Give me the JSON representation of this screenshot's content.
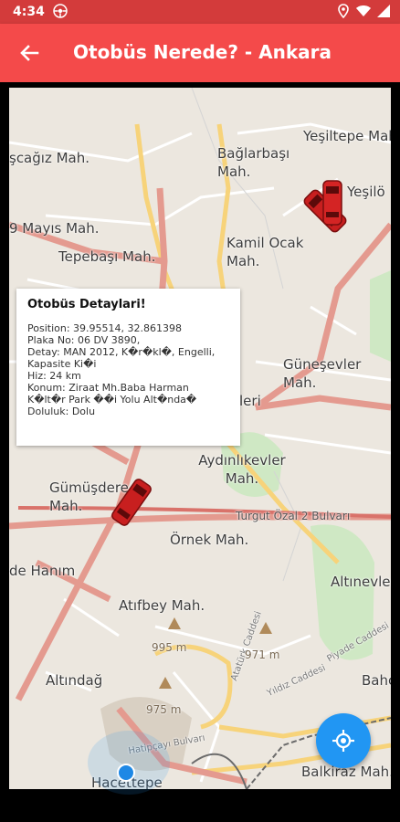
{
  "status_bar": {
    "time": "4:34",
    "left_icon": "gamepad-icon",
    "right_icons": [
      "location-icon",
      "wifi-icon",
      "signal-icon"
    ]
  },
  "app_bar": {
    "title": "Otobüs Nerede? - Ankara",
    "back_icon": "back-arrow-icon",
    "background": "#f44a4a",
    "status_background": "#d33b3b"
  },
  "map": {
    "labels": [
      "Yeşiltepe Mah.",
      "şcağız Mah.",
      "Bağlarbaşı Mah.",
      "Yeşilö",
      "9 Mayıs Mah.",
      "Tepebaşı Mah.",
      "Kamil Ocak Mah.",
      "Güneşevler Mah.",
      "leri",
      "Aydınlıkevler Mah.",
      "Gümüşdere Mah.",
      "Turgut Özal 2 Bulvarı",
      "Örnek Mah.",
      "de Hanım",
      "Altınevler",
      "Atıfbey Mah.",
      "Altındağ",
      "Bahçe",
      "Hacettepe",
      "Balkiraz Mah.",
      "Atatürk Caddesi",
      "Yıldız Caddesi",
      "Piyade Caddesi",
      "Hatipçayı Bulvarı"
    ],
    "elevations": [
      "995 m",
      "971 m",
      "975 m"
    ]
  },
  "info_window": {
    "title": "Otobüs Detaylari!",
    "lines": [
      "Position: 39.95514, 32.861398",
      "Plaka No: 06 DV 3890,",
      "Detay: MAN 2012, K�r�kl�, Engelli,",
      "Kapasite  Ki�i",
      "Hiz: 24 km",
      "Konum: Ziraat Mh.Baba Harman",
      "K�lt�r Park ��i Yolu Alt�nda�",
      "Doluluk: Dolu"
    ]
  },
  "fab": {
    "icon": "my-location-icon",
    "color": "#2196f3"
  },
  "bus_icon": "bus-marker-icon"
}
